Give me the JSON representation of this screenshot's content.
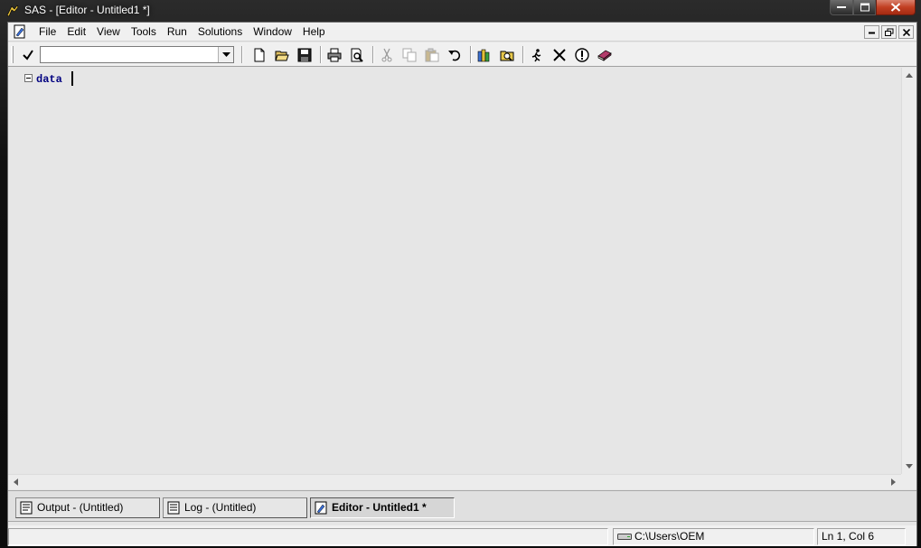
{
  "window": {
    "title": "SAS - [Editor - Untitled1 *]"
  },
  "menu": {
    "items": [
      "File",
      "Edit",
      "View",
      "Tools",
      "Run",
      "Solutions",
      "Window",
      "Help"
    ]
  },
  "toolbar": {
    "command_value": "",
    "icons": [
      "new-icon",
      "open-icon",
      "save-icon",
      "print-icon",
      "print-preview-icon",
      "cut-icon",
      "copy-icon",
      "paste-icon",
      "undo-icon",
      "libraries-icon",
      "explorer-icon",
      "submit-icon",
      "clear-icon",
      "break-icon",
      "help-icon"
    ]
  },
  "editor": {
    "code": "data"
  },
  "tasks": [
    {
      "label": "Output - (Untitled)",
      "active": false
    },
    {
      "label": "Log - (Untitled)",
      "active": false
    },
    {
      "label": "Editor - Untitled1 *",
      "active": true
    }
  ],
  "status": {
    "path": "C:\\Users\\OEM",
    "position": "Ln 1, Col 6"
  },
  "colors": {
    "code_keyword": "#000080",
    "close_button": "#c13f22"
  }
}
